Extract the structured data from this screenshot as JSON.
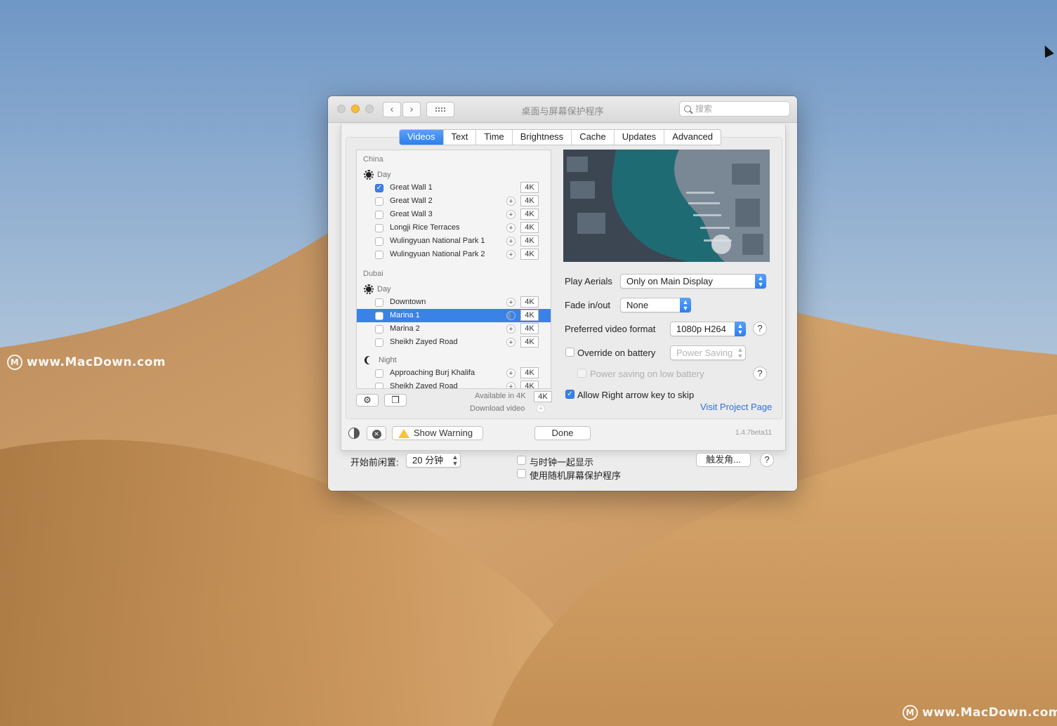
{
  "watermark": {
    "text": "www.MacDown.com",
    "logo": "M"
  },
  "window": {
    "title": "桌面与屏幕保护程序",
    "search_placeholder": "搜索",
    "back_icon": "‹",
    "forward_icon": "›"
  },
  "tabs": [
    "Videos",
    "Text",
    "Time",
    "Brightness",
    "Cache",
    "Updates",
    "Advanced"
  ],
  "list": {
    "sections": [
      {
        "name": "China",
        "groups": [
          {
            "name": "Day",
            "icon": "sun-icon",
            "items": [
              {
                "label": "Great Wall 1",
                "checked": true,
                "plus": false,
                "badge": "4K"
              },
              {
                "label": "Great Wall 2",
                "checked": false,
                "plus": true,
                "badge": "4K"
              },
              {
                "label": "Great Wall 3",
                "checked": false,
                "plus": true,
                "badge": "4K"
              },
              {
                "label": "Longji Rice Terraces",
                "checked": false,
                "plus": true,
                "badge": "4K"
              },
              {
                "label": "Wulingyuan National Park 1",
                "checked": false,
                "plus": true,
                "badge": "4K"
              },
              {
                "label": "Wulingyuan National Park 2",
                "checked": false,
                "plus": true,
                "badge": "4K"
              }
            ]
          }
        ]
      },
      {
        "name": "Dubai",
        "groups": [
          {
            "name": "Day",
            "icon": "sun-icon",
            "items": [
              {
                "label": "Downtown",
                "checked": false,
                "plus": true,
                "badge": "4K"
              },
              {
                "label": "Marina 1",
                "checked": false,
                "plus": true,
                "badge": "4K",
                "selected": true
              },
              {
                "label": "Marina 2",
                "checked": false,
                "plus": true,
                "badge": "4K"
              },
              {
                "label": "Sheikh Zayed Road",
                "checked": false,
                "plus": true,
                "badge": "4K"
              }
            ]
          },
          {
            "name": "Night",
            "icon": "moon-icon",
            "items": [
              {
                "label": "Approaching Burj Khalifa",
                "checked": false,
                "plus": true,
                "badge": "4K"
              },
              {
                "label": "Sheikh Zayed Road",
                "checked": false,
                "plus": true,
                "badge": "4K"
              }
            ]
          }
        ]
      }
    ],
    "legend_available": "Available in 4K",
    "legend_badge": "4K",
    "legend_download": "Download video",
    "gear_icon": "⚙",
    "book_icon": "❒"
  },
  "settings": {
    "play_aerials_label": "Play Aerials",
    "play_aerials_value": "Only on Main Display",
    "fade_label": "Fade in/out",
    "fade_value": "None",
    "format_label": "Preferred video format",
    "format_value": "1080p H264",
    "override_label": "Override on battery",
    "override_value": "Power Saving",
    "power_saving_label": "Power saving on low battery",
    "right_arrow_label": "Allow Right arrow key to skip",
    "visit_link": "Visit Project Page",
    "help": "?"
  },
  "footer": {
    "show_warning": "Show Warning",
    "done": "Done",
    "version": "1.4.7beta11"
  },
  "bottom": {
    "idle_label": "开始前闲置:",
    "idle_value": "20 分钟",
    "show_clock": "与时钟一起显示",
    "random": "使用随机屏幕保护程序",
    "hot_corners": "触发角...",
    "help": "?"
  },
  "colors": {
    "accent": "#3b82e8",
    "link": "#2e6fdc"
  }
}
